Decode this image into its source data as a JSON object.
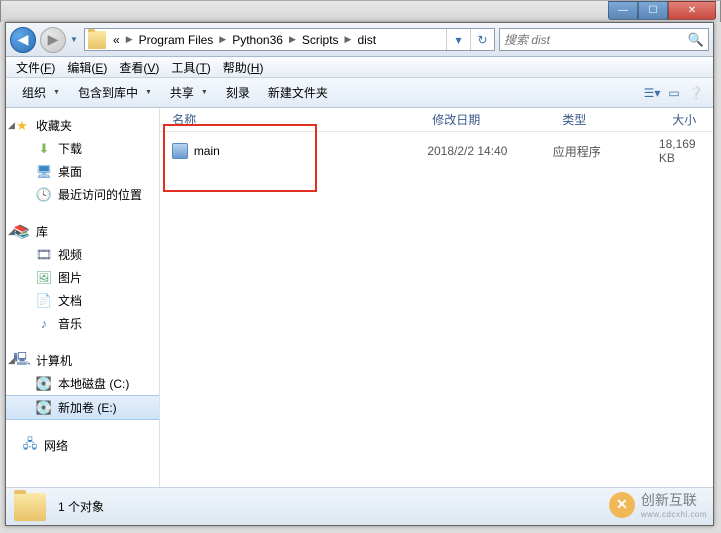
{
  "window": {
    "min_label": "—",
    "max_label": "☐",
    "close_label": "✕"
  },
  "breadcrumbs": [
    "«",
    "Program Files",
    "Python36",
    "Scripts",
    "dist"
  ],
  "search": {
    "placeholder": "搜索 dist"
  },
  "menubar": [
    {
      "label": "文件",
      "key": "F"
    },
    {
      "label": "编辑",
      "key": "E"
    },
    {
      "label": "查看",
      "key": "V"
    },
    {
      "label": "工具",
      "key": "T"
    },
    {
      "label": "帮助",
      "key": "H"
    }
  ],
  "toolbar": {
    "organize": "组织",
    "include": "包含到库中",
    "share": "共享",
    "burn": "刻录",
    "newfolder": "新建文件夹"
  },
  "sidebar": {
    "favorites": {
      "label": "收藏夹"
    },
    "downloads": {
      "label": "下载"
    },
    "desktop": {
      "label": "桌面"
    },
    "recent": {
      "label": "最近访问的位置"
    },
    "library": {
      "label": "库"
    },
    "video": {
      "label": "视频"
    },
    "pictures": {
      "label": "图片"
    },
    "documents": {
      "label": "文档"
    },
    "music": {
      "label": "音乐"
    },
    "computer": {
      "label": "计算机"
    },
    "localdisk": {
      "label": "本地磁盘 (C:)"
    },
    "newvolume": {
      "label": "新加卷 (E:)"
    },
    "network": {
      "label": "网络"
    }
  },
  "columns": {
    "name": "名称",
    "date": "修改日期",
    "type": "类型",
    "size": "大小"
  },
  "files": [
    {
      "name": "main",
      "date": "2018/2/2 14:40",
      "type": "应用程序",
      "size": "18,169 KB"
    }
  ],
  "status": {
    "text": "1 个对象"
  },
  "watermark": {
    "brand": "创新互联",
    "sub": "www.cdcxhl.com"
  }
}
